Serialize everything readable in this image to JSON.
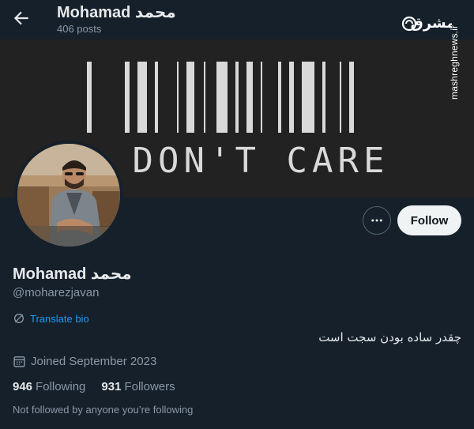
{
  "header": {
    "display_name": "Mohamad محمد",
    "post_count": "406 posts"
  },
  "watermark": {
    "logo_text": "مشرق",
    "site": "mashreghnews.ir"
  },
  "banner": {
    "text": "I DON'T CARE"
  },
  "profile": {
    "display_name": "Mohamad محمد",
    "handle": "@moharezjavan",
    "translate_label": "Translate bio",
    "bio": "چقدر ساده بودن سجت است",
    "joined": "Joined September 2023",
    "following_count": "946",
    "following_label": "Following",
    "followers_count": "931",
    "followers_label": "Followers",
    "not_followed_note": "Not followed by anyone you’re following"
  },
  "actions": {
    "follow_label": "Follow",
    "more_icon": "ellipsis-icon"
  },
  "colors": {
    "background": "#15202b",
    "accent": "#1d9bf0",
    "muted": "#8b98a5"
  }
}
